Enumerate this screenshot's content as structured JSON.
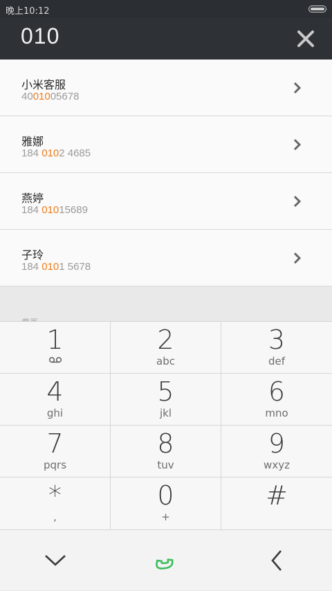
{
  "status_bar": {
    "time": "晚上10:12"
  },
  "header": {
    "number": "010"
  },
  "results": [
    {
      "name": "小米客服",
      "number_pre": "40",
      "number_match": "010",
      "number_post": "05678"
    },
    {
      "name": "雅娜",
      "number_pre": "184 ",
      "number_match": "010",
      "number_post": "2 4685"
    },
    {
      "name": "燕婷",
      "number_pre": "184 ",
      "number_match": "010",
      "number_post": "15689"
    },
    {
      "name": "子玲",
      "number_pre": "184 ",
      "number_match": "010",
      "number_post": "1 5678"
    }
  ],
  "section_label": "黄页",
  "keypad": [
    {
      "digit": "1",
      "letters": ""
    },
    {
      "digit": "2",
      "letters": "abc"
    },
    {
      "digit": "3",
      "letters": "def"
    },
    {
      "digit": "4",
      "letters": "ghi"
    },
    {
      "digit": "5",
      "letters": "jkl"
    },
    {
      "digit": "6",
      "letters": "mno"
    },
    {
      "digit": "7",
      "letters": "pqrs"
    },
    {
      "digit": "8",
      "letters": "tuv"
    },
    {
      "digit": "9",
      "letters": "wxyz"
    },
    {
      "digit": "*",
      "letters": ","
    },
    {
      "digit": "0",
      "letters": "+"
    },
    {
      "digit": "#",
      "letters": ""
    }
  ],
  "icons": {
    "clear": "close-icon",
    "row_arrow": "chevron-right-icon",
    "voicemail": "voicemail-icon",
    "collapse": "chevron-down-icon",
    "call": "phone-icon",
    "back": "chevron-left-icon"
  },
  "colors": {
    "accent": "#f07d1a",
    "call": "#3dbd5c",
    "header": "#2e3236"
  }
}
